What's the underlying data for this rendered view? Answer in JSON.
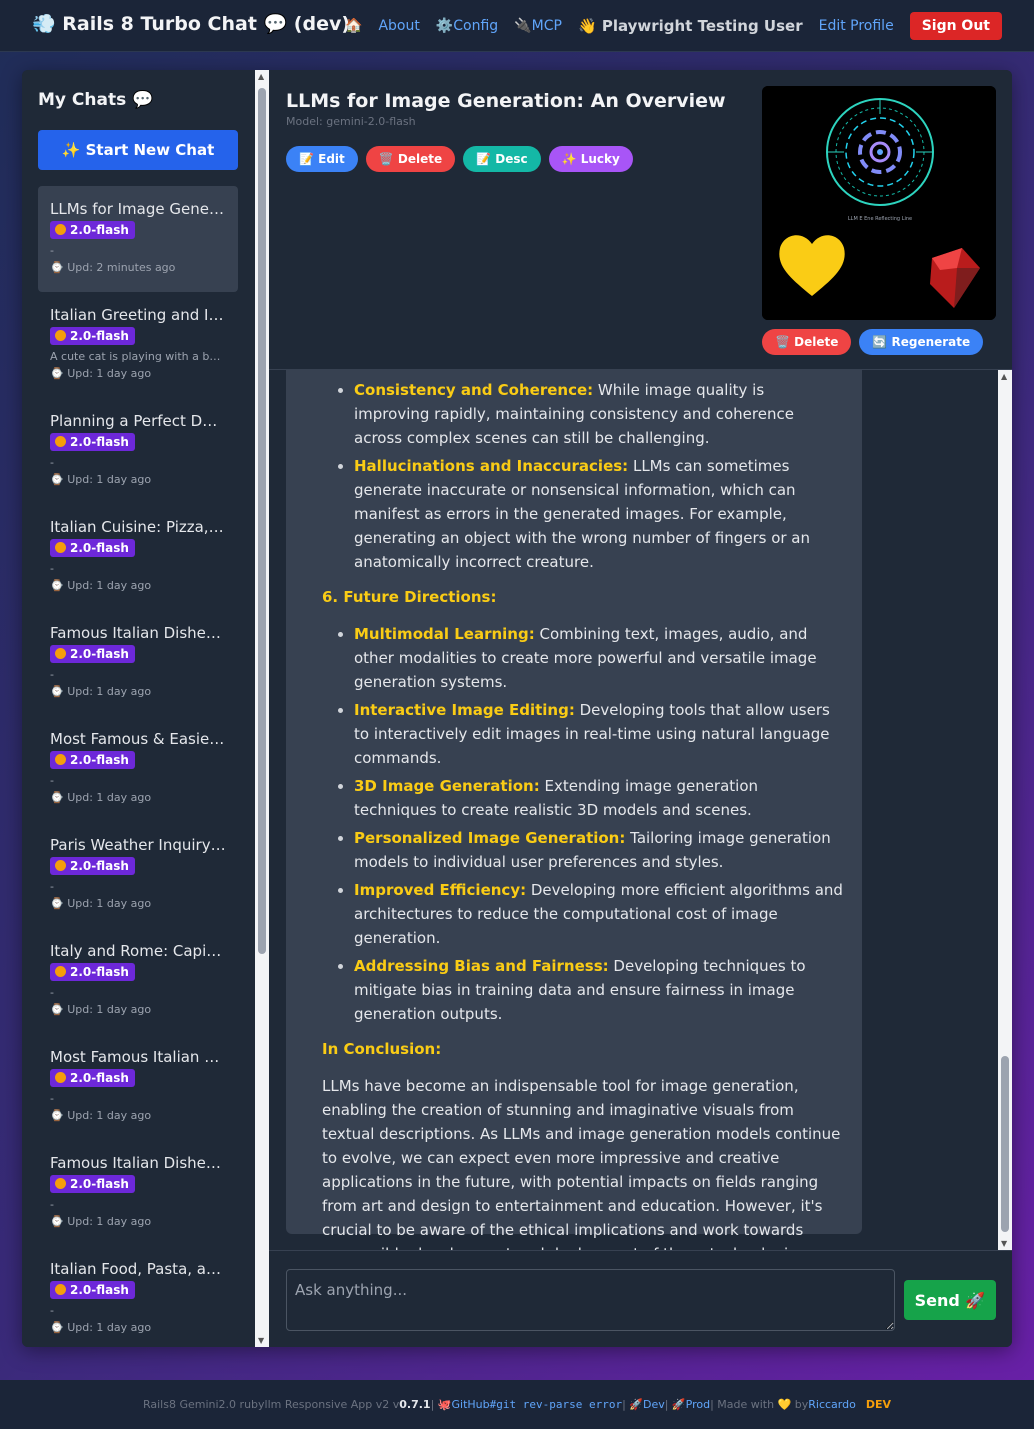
{
  "nav": {
    "brand": "💨 Rails 8 Turbo Chat 💬 (dev)",
    "home": "🏠",
    "about": "About",
    "config": "⚙️Config",
    "mcp": "🔌MCP",
    "user": "👋 Playwright Testing User",
    "edit_profile": "Edit Profile",
    "sign_out": "Sign Out"
  },
  "sidebar": {
    "title": "My Chats 💬",
    "new_chat": "✨ Start New Chat",
    "chats": [
      {
        "title": "LLMs for Image Generation: An Overview",
        "badge": "2.0-flash",
        "desc": "-",
        "updated": "Upd: 2 minutes ago"
      },
      {
        "title": "Italian Greeting and Introduction",
        "badge": "2.0-flash",
        "desc": "A cute cat is playing with a ball of yarn",
        "updated": "Upd: 1 day ago"
      },
      {
        "title": "Planning a Perfect Day in Rome",
        "badge": "2.0-flash",
        "desc": "-",
        "updated": "Upd: 1 day ago"
      },
      {
        "title": "Italian Cuisine: Pizza, Pasta and More",
        "badge": "2.0-flash",
        "desc": "-",
        "updated": "Upd: 1 day ago"
      },
      {
        "title": "Famous Italian Dishes Explained",
        "badge": "2.0-flash",
        "desc": "-",
        "updated": "Upd: 1 day ago"
      },
      {
        "title": "Most Famous & Easiest Recipes",
        "badge": "2.0-flash",
        "desc": "-",
        "updated": "Upd: 1 day ago"
      },
      {
        "title": "Paris Weather Inquiry Today",
        "badge": "2.0-flash",
        "desc": "-",
        "updated": "Upd: 1 day ago"
      },
      {
        "title": "Italy and Rome: Capital Facts",
        "badge": "2.0-flash",
        "desc": "-",
        "updated": "Upd: 1 day ago"
      },
      {
        "title": "Most Famous Italian Desserts",
        "badge": "2.0-flash",
        "desc": "-",
        "updated": "Upd: 1 day ago"
      },
      {
        "title": "Famous Italian Dishes List",
        "badge": "2.0-flash",
        "desc": "-",
        "updated": "Upd: 1 day ago"
      },
      {
        "title": "Italian Food, Pasta, and Wine",
        "badge": "2.0-flash",
        "desc": "-",
        "updated": "Upd: 1 day ago"
      }
    ]
  },
  "main": {
    "title": "LLMs for Image Generation: An Overview",
    "model": "Model: gemini-2.0-flash",
    "actions": {
      "edit": "📝 Edit",
      "delete": "🗑️ Delete",
      "desc": "📝 Desc",
      "lucky": "✨ Lucky"
    },
    "image_caption": "LLM E Ene Reflecting Line",
    "image_actions": {
      "delete": "🗑️ Delete",
      "regenerate": "🔄 Regenerate"
    },
    "list1": [
      {
        "head": "Consistency and Coherence:",
        "text": " While image quality is improving rapidly, maintaining consistency and coherence across complex scenes can still be challenging."
      },
      {
        "head": "Hallucinations and Inaccuracies:",
        "text": " LLMs can sometimes generate inaccurate or nonsensical information, which can manifest as errors in the generated images. For example, generating an object with the wrong number of fingers or an anatomically incorrect creature."
      }
    ],
    "section_future": "6. Future Directions:",
    "list2": [
      {
        "head": "Multimodal Learning:",
        "text": " Combining text, images, audio, and other modalities to create more powerful and versatile image generation systems."
      },
      {
        "head": "Interactive Image Editing:",
        "text": " Developing tools that allow users to interactively edit images in real-time using natural language commands."
      },
      {
        "head": "3D Image Generation:",
        "text": " Extending image generation techniques to create realistic 3D models and scenes."
      },
      {
        "head": "Personalized Image Generation:",
        "text": " Tailoring image generation models to individual user preferences and styles."
      },
      {
        "head": "Improved Efficiency:",
        "text": " Developing more efficient algorithms and architectures to reduce the computational cost of image generation."
      },
      {
        "head": "Addressing Bias and Fairness:",
        "text": " Developing techniques to mitigate bias in training data and ensure fairness in image generation outputs."
      }
    ],
    "section_conclusion": "In Conclusion:",
    "conclusion": "LLMs have become an indispensable tool for image generation, enabling the creation of stunning and imaginative visuals from textual descriptions. As LLMs and image generation models continue to evolve, we can expect even more impressive and creative applications in the future, with potential impacts on fields ranging from art and design to entertainment and education. However, it's crucial to be aware of the ethical implications and work towards responsible development and deployment of these technologies.",
    "input_placeholder": "Ask anything...",
    "send": "Send 🚀"
  },
  "footer": {
    "prefix": "Rails8 Gemini2.0 rubyllm Responsive App v2 v",
    "version": "0.7.1",
    "sep1": " | 🐙 ",
    "github": "GitHub",
    "git": " #git rev-parse error",
    "sep2": " | 🚀 ",
    "dev_link": "Dev",
    "sep3": " | 🚀 ",
    "prod": "Prod",
    "made": " | Made with 💛 by ",
    "author": "Riccardo",
    "env": "DEV"
  },
  "colors": {
    "accent": "#2563eb",
    "highlight": "#facc15",
    "danger": "#dc2626",
    "success": "#16a34a",
    "badge": "#6d28d9"
  }
}
